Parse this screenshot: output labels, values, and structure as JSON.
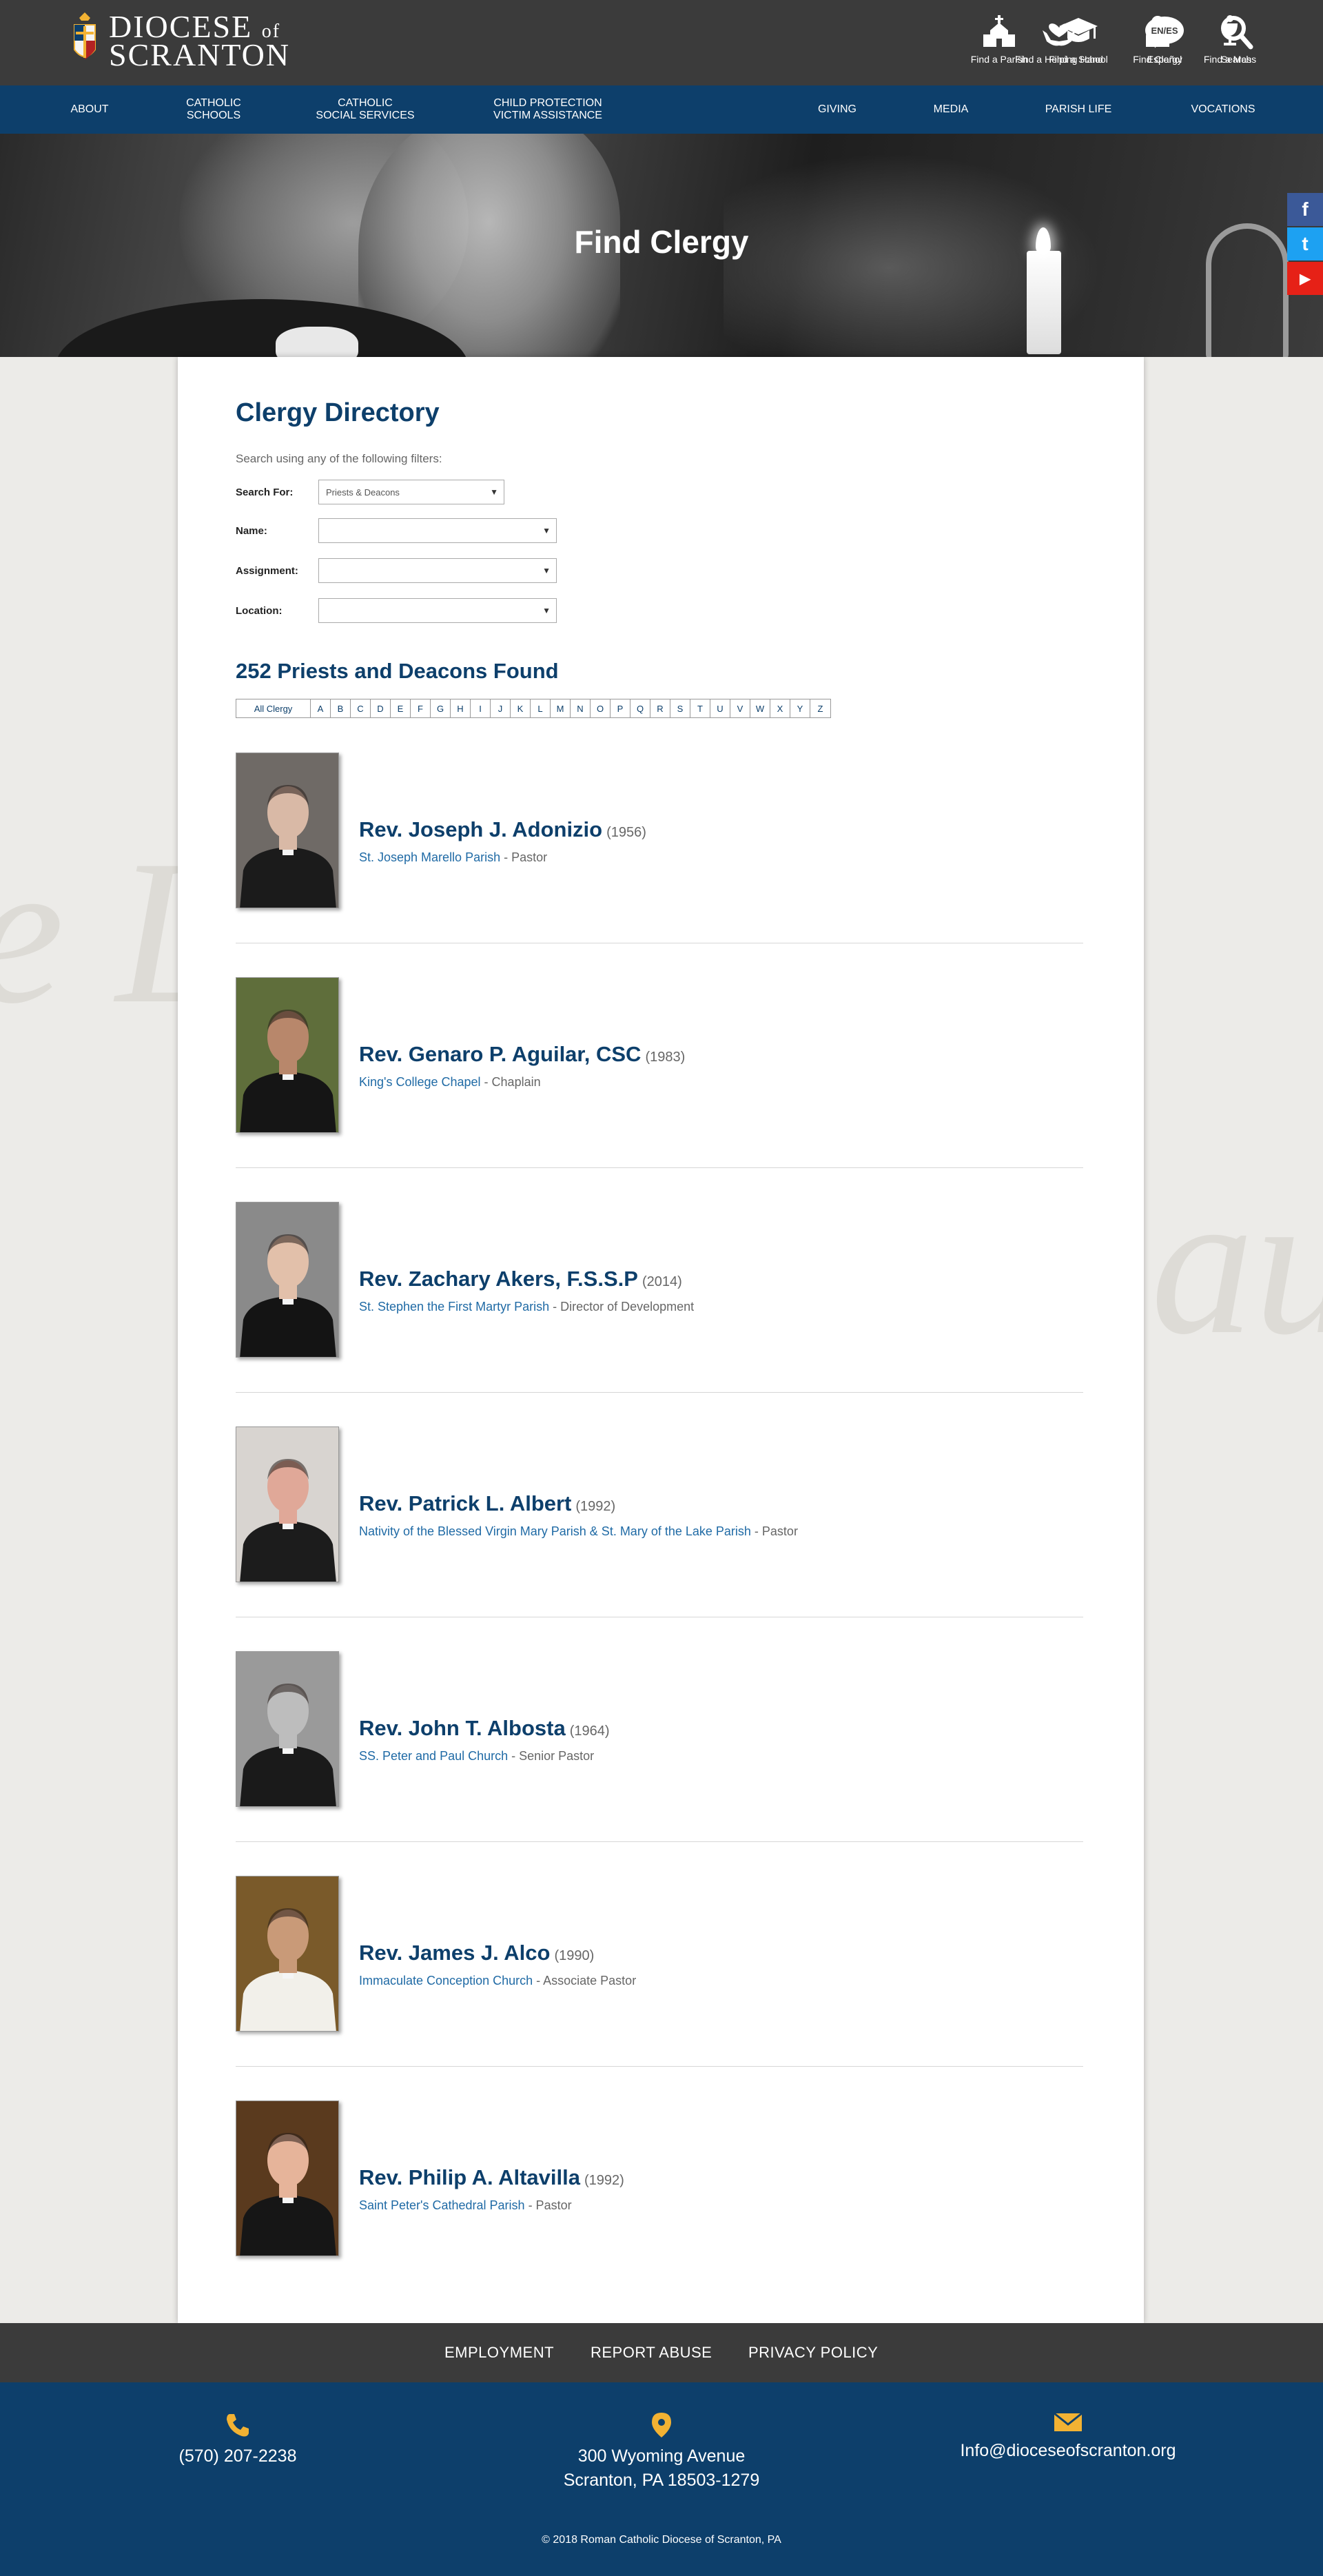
{
  "brand": {
    "name_line1": "DIOCESE",
    "name_of": "of",
    "name_line2": "SCRANTON",
    "accent": "#0d3f6b",
    "gold": "#f2b233"
  },
  "header_links": [
    {
      "label": "Find a Parish",
      "icon": "church-icon"
    },
    {
      "label": "Find a School",
      "icon": "graduation-cap-icon"
    },
    {
      "label": "Find Clergy",
      "icon": "priest-icon"
    },
    {
      "label": "Find a Mass",
      "icon": "chalice-icon"
    },
    {
      "label": "Find a Helping Hand",
      "icon": "helping-hand-icon"
    },
    {
      "label": "Español",
      "icon": "language-bubble-icon",
      "badge": "EN/ES"
    },
    {
      "label": "Search",
      "icon": "search-icon"
    }
  ],
  "main_nav": {
    "about": "ABOUT",
    "catholic_schools": "CATHOLIC\nSCHOOLS",
    "social_services": "CATHOLIC\nSOCIAL SERVICES",
    "child_protection": "CHILD PROTECTION\nVICTIM ASSISTANCE",
    "giving": "GIVING",
    "media": "MEDIA",
    "parish_life": "PARISH LIFE",
    "vocations": "VOCATIONS"
  },
  "hero": {
    "title": "Find Clergy"
  },
  "social": [
    {
      "name": "facebook-icon",
      "glyph": "f",
      "color": "#3b5998"
    },
    {
      "name": "twitter-icon",
      "glyph": "t",
      "color": "#1da1f2"
    },
    {
      "name": "youtube-icon",
      "glyph": "▶",
      "color": "#e62117"
    }
  ],
  "directory": {
    "title": "Clergy Directory",
    "hint": "Search using any of the following filters:",
    "filters": {
      "search_for_label": "Search For:",
      "search_for_value": "Priests & Deacons",
      "name_label": "Name:",
      "name_value": "",
      "assignment_label": "Assignment:",
      "assignment_value": "",
      "location_label": "Location:",
      "location_value": ""
    },
    "results_count": "252 Priests and Deacons Found",
    "alphabet_all": "All Clergy",
    "alphabet": [
      "A",
      "B",
      "C",
      "D",
      "E",
      "F",
      "G",
      "H",
      "I",
      "J",
      "K",
      "L",
      "M",
      "N",
      "O",
      "P",
      "Q",
      "R",
      "S",
      "T",
      "U",
      "V",
      "W",
      "X",
      "Y",
      "Z"
    ]
  },
  "clergy": [
    {
      "name": "Rev. Joseph J. Adonizio",
      "year": "(1956)",
      "place": "St. Joseph Marello Parish",
      "role": " - Pastor",
      "bg": "#6f6a66",
      "robe": "#1b1b1b",
      "face": "#d9b9a6"
    },
    {
      "name": "Rev. Genaro P. Aguilar, CSC",
      "year": "(1983)",
      "place": "King's College Chapel",
      "role": "  - Chaplain",
      "bg": "#5f6e3b",
      "robe": "#151515",
      "face": "#b8876b"
    },
    {
      "name": "Rev. Zachary Akers, F.S.S.P",
      "year": "(2014)",
      "place": "St. Stephen the First Martyr Parish",
      "role": " - Director of Development",
      "bg": "#8a8a8a",
      "robe": "#141414",
      "face": "#e2c0aa"
    },
    {
      "name": "Rev. Patrick L. Albert",
      "year": "(1992)",
      "place": "Nativity of the Blessed Virgin Mary Parish & St. Mary of the Lake Parish",
      "role": " - Pastor",
      "bg": "#d8d4d0",
      "robe": "#1c1c1c",
      "face": "#e0a898"
    },
    {
      "name": "Rev. John T. Albosta",
      "year": "(1964)",
      "place": "SS. Peter and Paul Church",
      "role": " - Senior Pastor",
      "bg": "#9a9a9a",
      "robe": "#1a1a1a",
      "face": "#bdbdbd"
    },
    {
      "name": "Rev. James J. Alco",
      "year": "(1990)",
      "place": "Immaculate Conception Church",
      "role": " - Associate Pastor",
      "bg": "#7a5a2a",
      "robe": "#f2f0ea",
      "face": "#c99a78"
    },
    {
      "name": "Rev. Philip A. Altavilla",
      "year": "(1992)",
      "place": "Saint Peter's Cathedral Parish",
      "role": " - Pastor",
      "bg": "#5a3a1e",
      "robe": "#161616",
      "face": "#e6b49a"
    }
  ],
  "footer_links": {
    "employment": "EMPLOYMENT",
    "report": "REPORT ABUSE",
    "privacy": "PRIVACY POLICY"
  },
  "contact": {
    "phone": "(570) 207-2238",
    "address_line1": "300 Wyoming Avenue",
    "address_line2": "Scranton, PA 18503-1279",
    "email": "Info@dioceseofscranton.org"
  },
  "copyright": "© 2018 Roman Catholic Diocese of Scranton, PA"
}
